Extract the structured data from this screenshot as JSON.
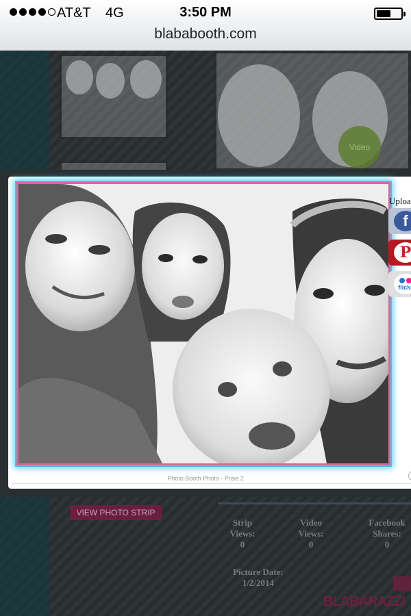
{
  "status_bar": {
    "signal_bars_filled": 4,
    "signal_bars_total": 5,
    "carrier": "AT&T",
    "network": "4G",
    "time": "3:50 PM",
    "battery_level": 0.55
  },
  "browser": {
    "url": "blababooth.com"
  },
  "background_page": {
    "view_strip_button": "VIEW PHOTO STRIP",
    "video_badge": "Video",
    "stats": [
      {
        "label_line1": "Strip",
        "label_line2": "Views:",
        "value": "0"
      },
      {
        "label_line1": "Video",
        "label_line2": "Views:",
        "value": "0"
      },
      {
        "label_line1": "Facebook",
        "label_line2": "Shares:",
        "value": "0"
      }
    ],
    "picture_date_label": "Picture Date:",
    "picture_date_value": "1/2/2014",
    "brand": "BLABARAZZI"
  },
  "lightbox": {
    "caption": "Photo Booth Photo - Pose 2",
    "upload_label": "Upload",
    "share_buttons": [
      {
        "name": "facebook",
        "icon": "facebook-icon",
        "glyph": "f"
      },
      {
        "name": "pinterest",
        "icon": "pinterest-icon",
        "glyph": "P"
      },
      {
        "name": "flickr",
        "icon": "flickr-icon",
        "glyph": "flickr"
      }
    ]
  },
  "colors": {
    "frame_pink": "#d56a9a",
    "frame_cyan": "#43c6e7",
    "brand_maroon": "#6b1f3f",
    "facebook_blue": "#3b5a9b",
    "pinterest_red": "#c8232c"
  }
}
